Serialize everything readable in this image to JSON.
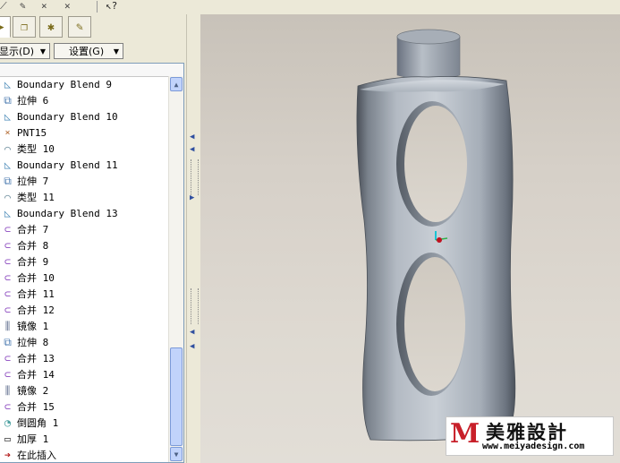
{
  "toolbar": {
    "icons": [
      "datum-display-icon",
      "sketch-display-icon",
      "point-display-icon",
      "csys-display-icon",
      "help-pointer-icon"
    ]
  },
  "navigator": {
    "tabs": [
      "model-tree-tab",
      "layers-tab",
      "folder-browser-tab",
      "favorites-tab"
    ],
    "show_menu": "显示(D)",
    "settings_menu": "设置(G)",
    "items": [
      {
        "label": "Boundary Blend 9",
        "icon": "boundary-blend-icon"
      },
      {
        "label": "拉伸 6",
        "icon": "extrude-icon"
      },
      {
        "label": "Boundary Blend 10",
        "icon": "boundary-blend-icon"
      },
      {
        "label": "PNT15",
        "icon": "datum-point-icon"
      },
      {
        "label": "类型 10",
        "icon": "style-feature-icon"
      },
      {
        "label": "Boundary Blend 11",
        "icon": "boundary-blend-icon"
      },
      {
        "label": "拉伸 7",
        "icon": "extrude-icon"
      },
      {
        "label": "类型 11",
        "icon": "style-feature-icon"
      },
      {
        "label": "Boundary Blend 13",
        "icon": "boundary-blend-icon"
      },
      {
        "label": "合并 7",
        "icon": "merge-icon"
      },
      {
        "label": "合并 8",
        "icon": "merge-icon"
      },
      {
        "label": "合并 9",
        "icon": "merge-icon"
      },
      {
        "label": "合并 10",
        "icon": "merge-icon"
      },
      {
        "label": "合并 11",
        "icon": "merge-icon"
      },
      {
        "label": "合并 12",
        "icon": "merge-icon"
      },
      {
        "label": "镜像 1",
        "icon": "mirror-icon"
      },
      {
        "label": "拉伸 8",
        "icon": "extrude-icon"
      },
      {
        "label": "合并 13",
        "icon": "merge-icon"
      },
      {
        "label": "合并 14",
        "icon": "merge-icon"
      },
      {
        "label": "镜像 2",
        "icon": "mirror-icon"
      },
      {
        "label": "合并 15",
        "icon": "merge-icon"
      },
      {
        "label": "倒圆角 1",
        "icon": "round-icon"
      },
      {
        "label": "加厚 1",
        "icon": "thicken-icon"
      },
      {
        "label": "在此插入",
        "icon": "insert-here-arrow-icon"
      }
    ]
  },
  "viewport": {
    "model": "bottle-shaped-surface-model",
    "background_top": "#c8c2b9",
    "background_bottom": "#e2ded7"
  },
  "watermark": {
    "brand_cn": "美雅設計",
    "url": "www.meiyadesign.com",
    "accent": "#c8202a"
  }
}
